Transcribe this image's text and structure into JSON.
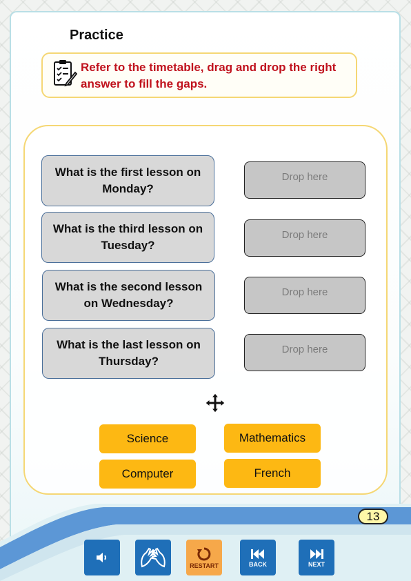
{
  "page": {
    "title": "Practice",
    "instruction": "Refer to the timetable, drag and drop the right answer to fill the gaps.",
    "page_number": "13"
  },
  "questions": [
    {
      "text": "What is the first lesson on Monday?",
      "drop_placeholder": "Drop here"
    },
    {
      "text": "What is the third lesson on Tuesday?",
      "drop_placeholder": "Drop here"
    },
    {
      "text": "What is the second lesson on Wednesday?",
      "drop_placeholder": "Drop here"
    },
    {
      "text": "What is the last lesson on Thursday?",
      "drop_placeholder": "Drop here"
    }
  ],
  "answers": [
    "Science",
    "Mathematics",
    "Computer",
    "French"
  ],
  "toolbar": {
    "audio_icon": "speaker-icon",
    "sign_icon": "sign-language-icon",
    "restart_label": "RESTART",
    "back_label": "BACK",
    "next_label": "NEXT"
  },
  "colors": {
    "accent_yellow": "#fdb813",
    "instruction_red": "#c0121d",
    "toolbar_blue": "#1f6fb8",
    "restart_orange": "#f6a84a",
    "panel_border": "#f5d774"
  }
}
